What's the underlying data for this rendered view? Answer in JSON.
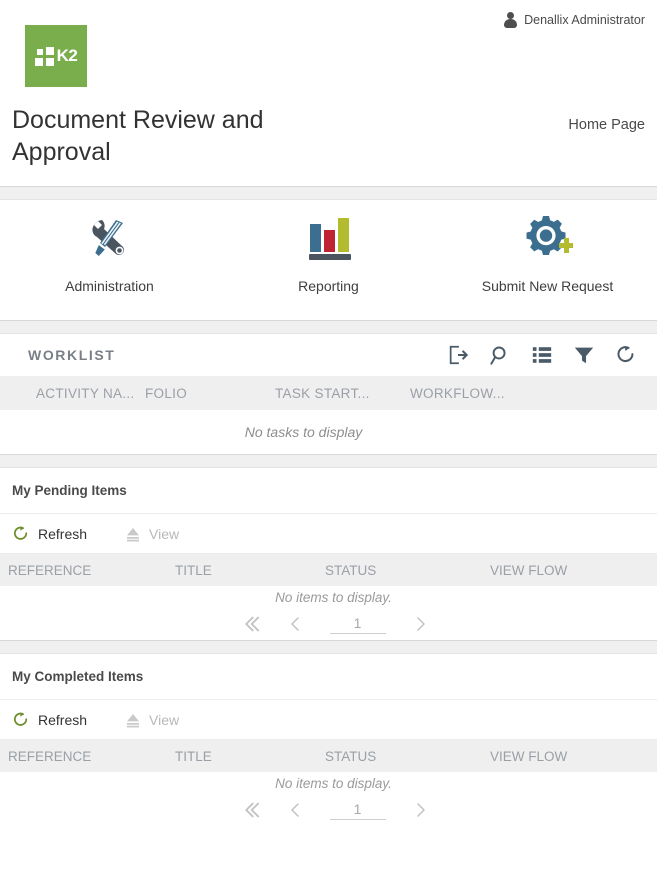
{
  "header": {
    "user_name": "Denallix Administrator",
    "logo_text": "K2",
    "app_title": "Document Review and Approval",
    "home_link": "Home Page"
  },
  "tiles": [
    {
      "label": "Administration",
      "icon": "wrench-screwdriver-icon"
    },
    {
      "label": "Reporting",
      "icon": "bar-chart-icon"
    },
    {
      "label": "Submit New Request",
      "icon": "gear-plus-icon"
    }
  ],
  "worklist": {
    "title": "WORKLIST",
    "tools": [
      {
        "name": "open-worklist-icon"
      },
      {
        "name": "search-icon"
      },
      {
        "name": "list-view-icon"
      },
      {
        "name": "filter-icon"
      },
      {
        "name": "refresh-icon"
      }
    ],
    "columns": [
      "ACTIVITY NA...",
      "FOLIO",
      "TASK START...",
      "WORKFLOW..."
    ],
    "empty_message": "No tasks to display"
  },
  "pending": {
    "title": "My Pending Items",
    "refresh_label": "Refresh",
    "view_label": "View",
    "columns": [
      "REFERENCE",
      "TITLE",
      "STATUS",
      "VIEW FLOW"
    ],
    "empty_message": "No items to display.",
    "page_number": "1"
  },
  "completed": {
    "title": "My Completed Items",
    "refresh_label": "Refresh",
    "view_label": "View",
    "columns": [
      "REFERENCE",
      "TITLE",
      "STATUS",
      "VIEW FLOW"
    ],
    "empty_message": "No items to display.",
    "page_number": "1"
  },
  "colors": {
    "brand_green": "#7aad4c",
    "icon_blue": "#3c6e8f",
    "icon_red": "#bf2432",
    "icon_olive": "#b3bc2e",
    "tool_slate": "#4a5a67",
    "refresh_green": "#6f8f2f"
  }
}
